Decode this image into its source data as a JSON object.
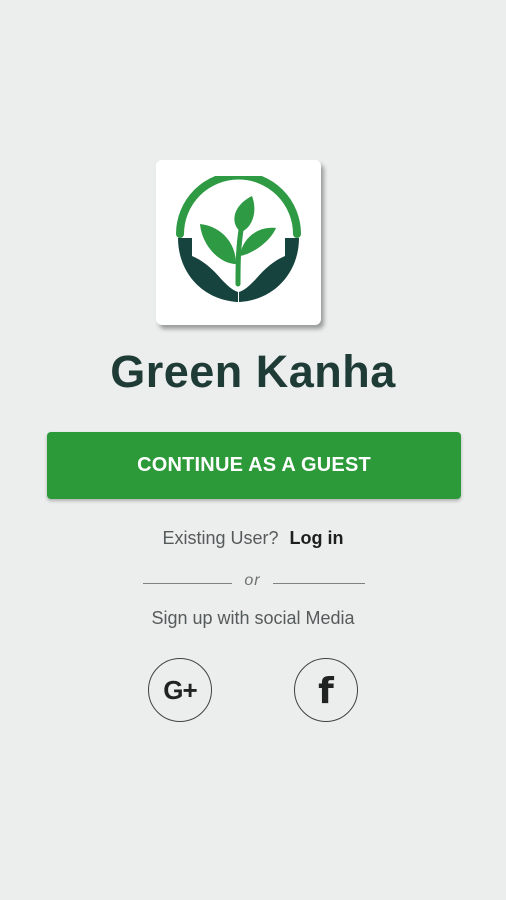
{
  "app": {
    "title": "Green Kanha",
    "logo_icon": "hands-sprout-icon"
  },
  "actions": {
    "guest_button_label": "CONTINUE AS A GUEST",
    "existing_user_text": "Existing User?",
    "login_link_label": "Log in",
    "divider_text": "or",
    "signup_social_label": "Sign up with social Media"
  },
  "social": {
    "google": {
      "icon": "google-plus-icon",
      "glyph": "G+"
    },
    "facebook": {
      "icon": "facebook-icon",
      "glyph": "f"
    }
  },
  "colors": {
    "background": "#eceeee",
    "primary": "#2c9a39",
    "title": "#1f3b36",
    "logo_dark": "#16433d",
    "logo_green": "#2e9a43"
  }
}
